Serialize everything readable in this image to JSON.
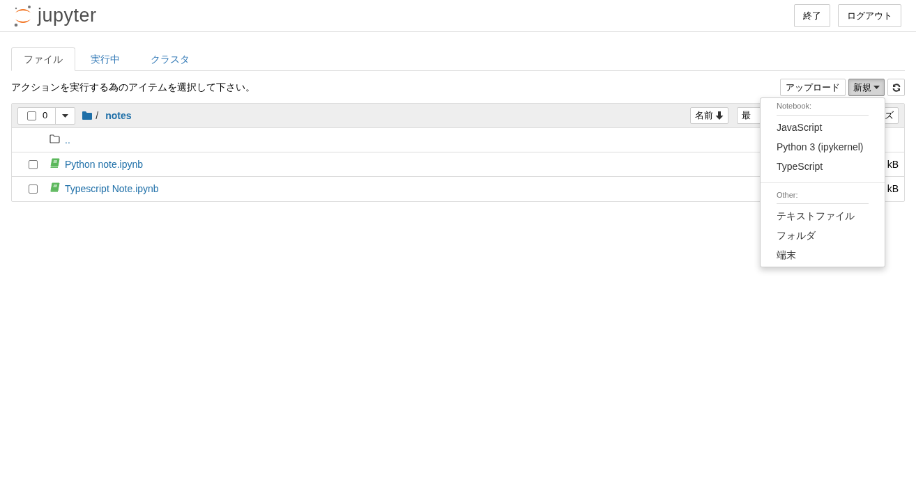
{
  "header": {
    "logo": "jupyter",
    "buttons": [
      "終了",
      "ログアウト"
    ]
  },
  "tabs": [
    {
      "label": "ファイル",
      "selected": true
    },
    {
      "label": "実行中",
      "selected": false
    },
    {
      "label": "クラスタ",
      "selected": false
    }
  ],
  "instruction": "アクションを実行する為のアイテムを選択して下さい。",
  "toolbar": {
    "upload": "アップロード",
    "new": {
      "label": "新規",
      "open": true
    }
  },
  "file_list": {
    "selected_count": "0",
    "all_checked": false,
    "breadcrumb": {
      "separator": "/",
      "folder": "notes"
    },
    "sort_columns": [
      {
        "label": "名前",
        "sorted": true
      },
      {
        "label": "最",
        "sorted": false
      },
      {
        "label": "ズ",
        "sorted": false
      }
    ],
    "rows": [
      {
        "kind": "parent",
        "name": ".."
      },
      {
        "kind": "notebook",
        "name": "Python note.ipynb",
        "checked": false,
        "size": "kB"
      },
      {
        "kind": "notebook",
        "name": "Typescript Note.ipynb",
        "checked": false,
        "size": "kB"
      }
    ]
  },
  "new_menu": {
    "sections": [
      {
        "heading": "Notebook:",
        "items": [
          "JavaScript",
          "Python 3 (ipykernel)",
          "TypeScript"
        ]
      },
      {
        "heading": "Other:",
        "items": [
          "テキストファイル",
          "フォルダ",
          "端末"
        ]
      }
    ]
  }
}
